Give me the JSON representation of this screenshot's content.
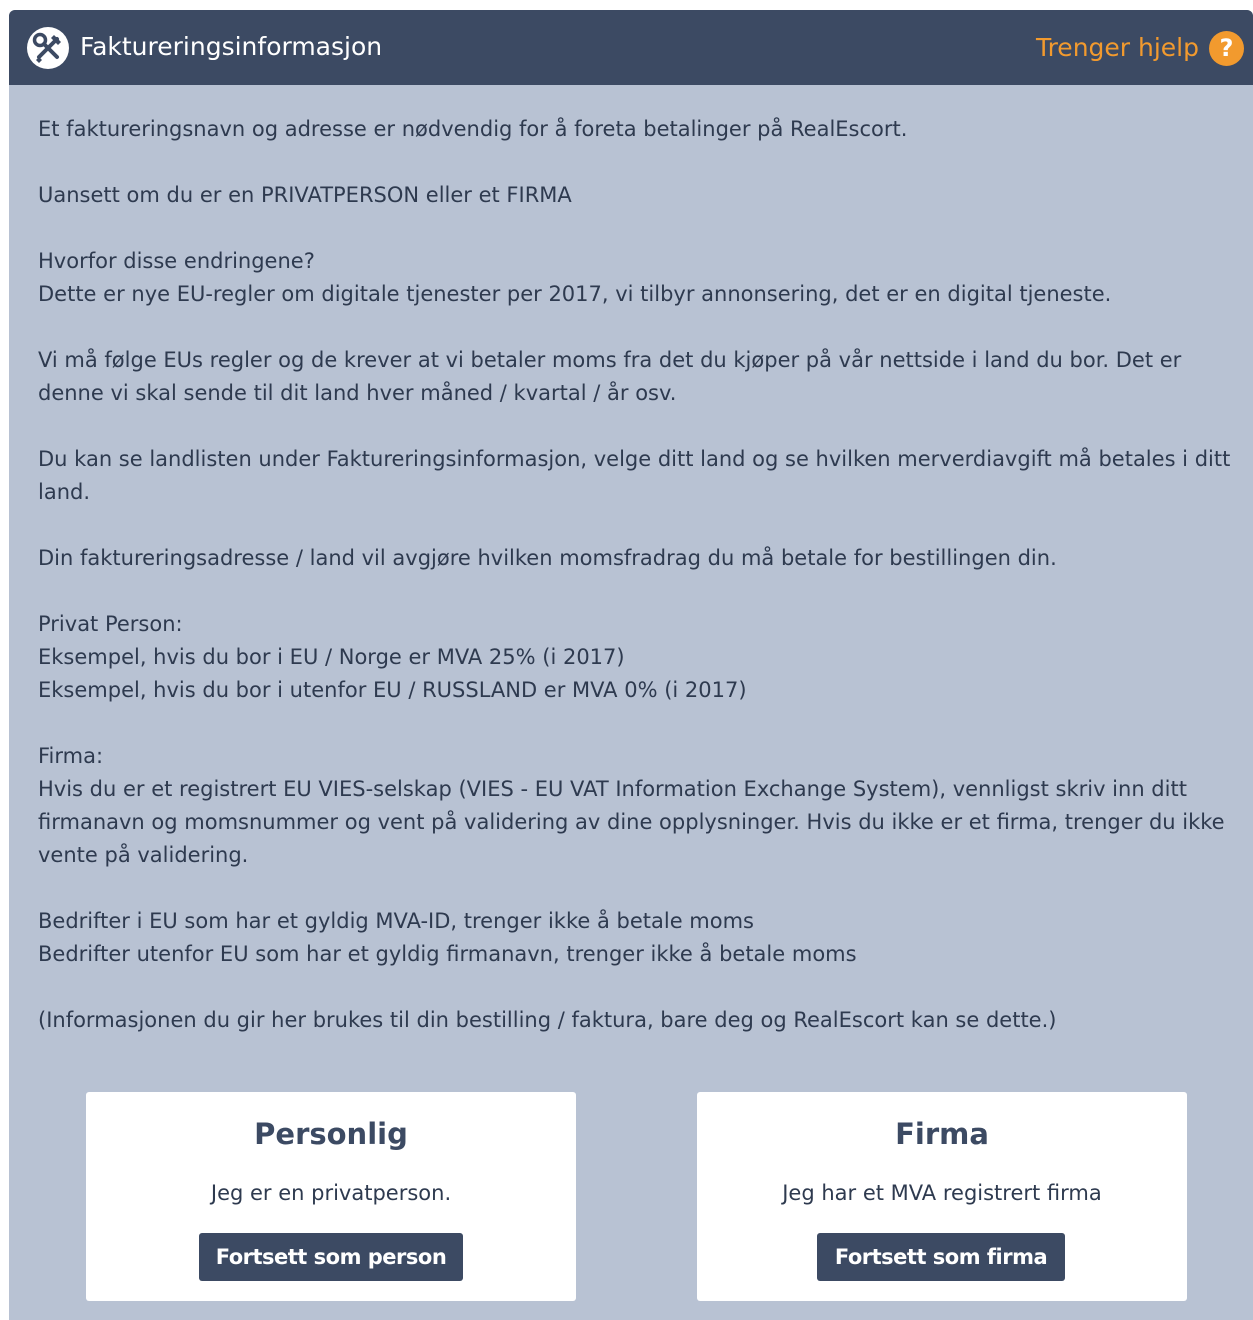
{
  "header": {
    "title": "Faktureringsinformasjon",
    "help_label": "Trenger hjelp",
    "help_icon_glyph": "?",
    "icon": "tools-icon"
  },
  "content": {
    "p1": "Et faktureringsnavn og adresse er nødvendig for å foreta betalinger på RealEscort.",
    "p2": "Uansett om du er en PRIVATPERSON eller et FIRMA",
    "p3_line1": "Hvorfor disse endringene?",
    "p3_line2": "Dette er nye EU-regler om digitale tjenester per 2017, vi tilbyr annonsering, det er en digital tjeneste.",
    "p4": "Vi må følge EUs regler og de krever at vi betaler moms fra det du kjøper på vår nettside i land du bor. Det er denne vi skal sende til dit land hver måned / kvartal / år osv.",
    "p5": "Du kan se landlisten under Faktureringsinformasjon, velge ditt land og se hvilken merverdiavgift må betales i ditt land.",
    "p6": "Din faktureringsadresse / land vil avgjøre hvilken momsfradrag du må betale for bestillingen din.",
    "p7_line1": "Privat Person:",
    "p7_line2": "Eksempel, hvis du bor i EU / Norge er MVA 25% (i 2017)",
    "p7_line3": "Eksempel, hvis du bor i utenfor EU / RUSSLAND er MVA 0% (i 2017)",
    "p8_line1": "Firma:",
    "p8_line2": "Hvis du er et registrert EU VIES-selskap (VIES - EU VAT Information Exchange System), vennligst skriv inn ditt firmanavn og momsnummer og vent på validering av dine opplysninger. Hvis du ikke er et firma, trenger du ikke vente på validering.",
    "p9_line1": "Bedrifter i EU som har et gyldig MVA-ID, trenger ikke å betale moms",
    "p9_line2": "Bedrifter utenfor EU som har et gyldig firmanavn, trenger ikke å betale moms",
    "p10": "(Informasjonen du gir her brukes til din bestilling / faktura, bare deg og RealEscort kan se dette.)"
  },
  "cards": {
    "person": {
      "title": "Personlig",
      "desc": "Jeg er en privatperson.",
      "button": "Fortsett som person"
    },
    "firma": {
      "title": "Firma",
      "desc": "Jeg har et MVA registrert firma",
      "button": "Fortsett som firma"
    }
  },
  "colors": {
    "header_bg": "#3c4a63",
    "panel_bg": "#b8c2d3",
    "accent_orange": "#f29a2e",
    "text": "#2e3a4f"
  }
}
